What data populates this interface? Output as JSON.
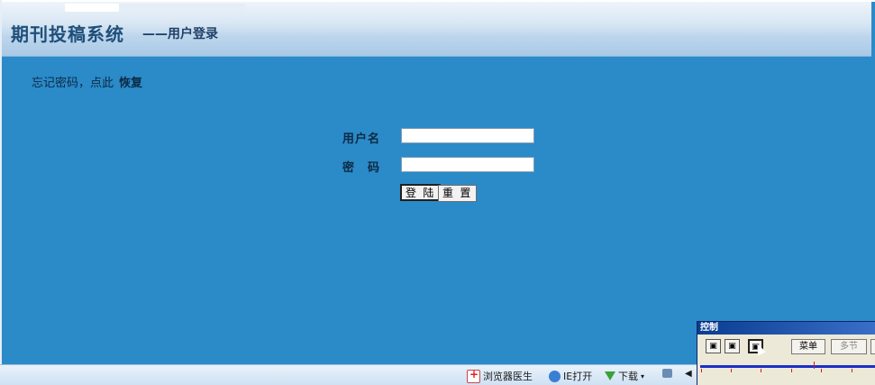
{
  "header": {
    "title": "期刊投稿系统",
    "subtitle": "——用户登录"
  },
  "recover": {
    "prompt": "忘记密码，点此",
    "link": "恢复"
  },
  "login": {
    "username_label": "用户名",
    "username_value": "",
    "password_label": "密　码",
    "password_value": "",
    "login_button": "登 陆",
    "reset_button": "重 置"
  },
  "statusbar": {
    "items": [
      {
        "label": "浏览器医生",
        "icon": "doctor-icon"
      },
      {
        "label": "IE打开",
        "icon": "ie-icon"
      },
      {
        "label": "下载",
        "icon": "download-icon"
      }
    ]
  },
  "control_panel": {
    "title": "控制",
    "menu_button": "菜单",
    "multi_button": "多节"
  },
  "colors": {
    "background": "#2b8ac8",
    "header_text": "#1f4f7a",
    "control_title": "#0a3d8f"
  }
}
